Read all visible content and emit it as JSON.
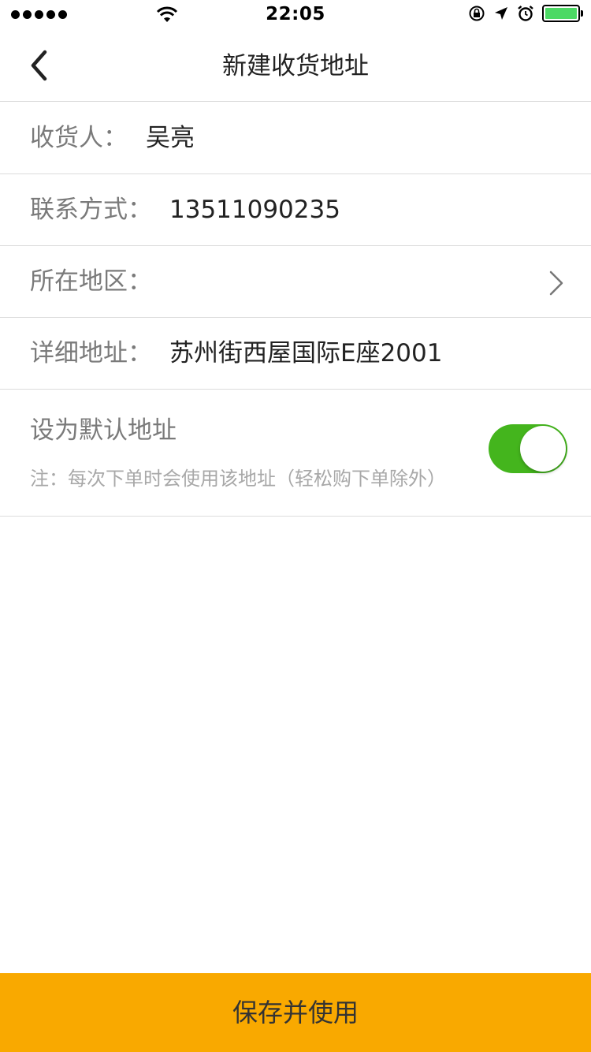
{
  "status_bar": {
    "time": "22:05",
    "icons": [
      "signal-dots-icon",
      "wifi-icon",
      "rotation-lock-icon",
      "location-arrow-icon",
      "alarm-icon",
      "battery-icon"
    ],
    "battery_color": "#4cd964"
  },
  "nav": {
    "title": "新建收货地址",
    "back_icon": "chevron-left-icon"
  },
  "form": {
    "receiver": {
      "label": "收货人：",
      "value": "吴亮"
    },
    "contact": {
      "label": "联系方式：",
      "value": "13511090235"
    },
    "region": {
      "label": "所在地区：",
      "value": "",
      "icon": "chevron-right-icon"
    },
    "address": {
      "label": "详细地址：",
      "value": "苏州街西屋国际E座2001"
    },
    "default_address": {
      "label": "设为默认地址",
      "note": "注：每次下单时会使用该地址（轻松购下单除外）",
      "enabled": true,
      "toggle_color": "#44b51d"
    }
  },
  "footer": {
    "save_label": "保存并使用",
    "button_color": "#f9a900"
  }
}
